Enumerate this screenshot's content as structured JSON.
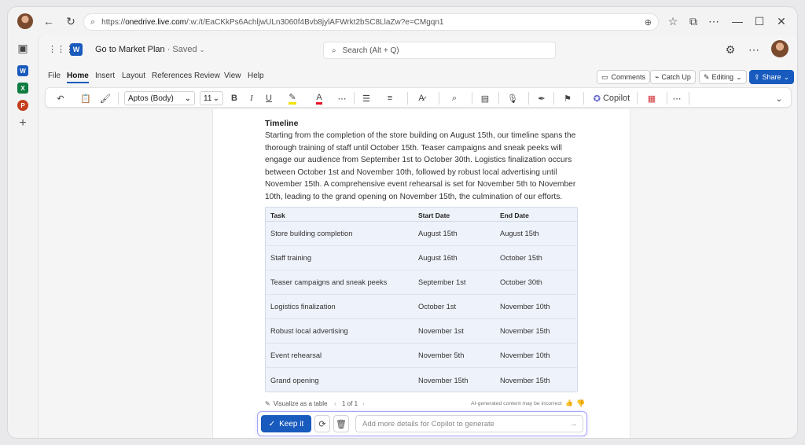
{
  "browser": {
    "url_prefix": "https://",
    "url_host": "onedrive.live.com",
    "url_path": "/:w:/t/EaCKkPs6AchljwULn3060f4Bvb8jylAFWrkt2bSC8LlaZw?e=CMgqn1"
  },
  "app": {
    "doc_title": "Go to Market Plan",
    "doc_status": " · Saved ",
    "search_placeholder": "Search (Alt + Q)"
  },
  "menu": {
    "items": [
      "File",
      "Home",
      "Insert",
      "Layout",
      "References",
      "Review",
      "View",
      "Help"
    ],
    "active": "Home"
  },
  "ribbon_buttons": {
    "comments": "Comments",
    "catchup": "Catch Up",
    "editing": "Editing",
    "share": "Share"
  },
  "toolbar": {
    "font_name": "Aptos (Body)",
    "font_size": "11",
    "bold": "B",
    "italic": "I",
    "underline": "U",
    "font_color": "A",
    "copilot": "Copilot"
  },
  "document": {
    "heading": "Timeline",
    "paragraph": "Starting from the completion of the store building on August 15th, our timeline spans the thorough training of staff until October 15th. Teaser campaigns and sneak peeks will engage our audience from September 1st to October 30th. Logistics finalization occurs between October 1st and November 10th, followed by robust local advertising until November 15th. A comprehensive event rehearsal is set for November 5th to November 10th, leading to the grand opening on November 15th, the culmination of our efforts.",
    "table": {
      "headers": [
        "Task",
        "Start Date",
        "End Date"
      ],
      "rows": [
        [
          "Store building completion",
          "August 15th",
          "August 15th"
        ],
        [
          "Staff training",
          "August 16th",
          "October 15th"
        ],
        [
          "Teaser campaigns and sneak peeks",
          "September 1st",
          "October 30th"
        ],
        [
          "Logistics finalization",
          "October 1st",
          "November 10th"
        ],
        [
          "Robust local advertising",
          "November 1st",
          "November 15th"
        ],
        [
          "Event rehearsal",
          "November 5th",
          "November 10th"
        ],
        [
          "Grand opening",
          "November 15th",
          "November 15th"
        ]
      ]
    }
  },
  "copilot": {
    "visualize": "Visualize as a table",
    "pager": "1 of 1",
    "disclaimer": "AI-generated content may be incorrect",
    "keep": "Keep it",
    "prompt_placeholder": "Add more details for Copilot to generate"
  },
  "colors": {
    "accent": "#185abd",
    "copilot_border": "#a7a3f5",
    "table_bg": "#eef2fa"
  }
}
